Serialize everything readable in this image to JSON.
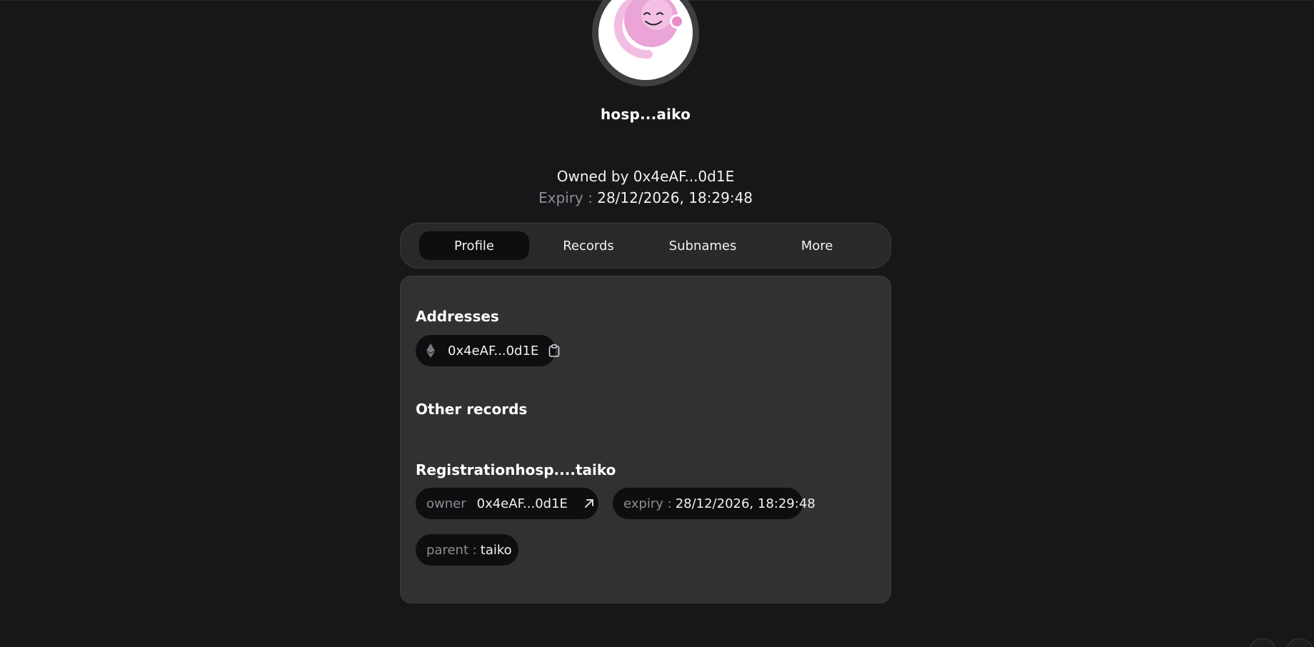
{
  "profile": {
    "name": "hosp...aiko",
    "owned_by_label": "Owned by",
    "owned_by_address": "0x4eAF...0d1E",
    "expiry_label": "Expiry :",
    "expiry_value": "28/12/2026, 18:29:48"
  },
  "tabs": [
    {
      "label": "Profile",
      "active": true
    },
    {
      "label": "Records",
      "active": false
    },
    {
      "label": "Subnames",
      "active": false
    },
    {
      "label": "More",
      "active": false
    }
  ],
  "addresses": {
    "title": "Addresses",
    "items": [
      {
        "coin_icon": "ethereum-icon",
        "address": "0x4eAF...0d1E",
        "action_icon": "clipboard-icon"
      }
    ]
  },
  "other_records": {
    "title": "Other records"
  },
  "registration": {
    "title": "Registrationhosp....taiko",
    "owner_label": "owner",
    "owner_value": "0x4eAF...0d1E",
    "owner_icon": "arrow-up-right-icon",
    "expiry_label": "expiry :",
    "expiry_value": "28/12/2026, 18:29:48",
    "parent_label": "parent :",
    "parent_value": "taiko"
  },
  "colors": {
    "background": "#17171a",
    "card": "#313134",
    "pill": "#0e0e10",
    "muted_text": "#8e8e92",
    "avatar_pink": "#f0a8dc"
  }
}
